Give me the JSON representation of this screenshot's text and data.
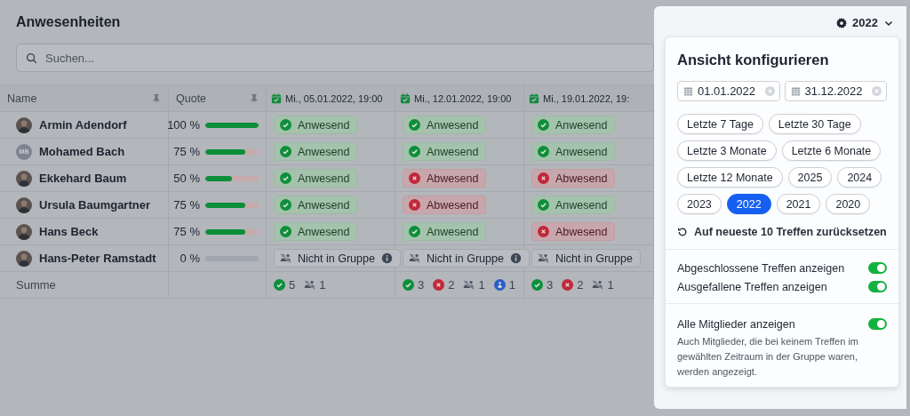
{
  "page": {
    "title": "Anwesenheiten",
    "search": {
      "placeholder": "Suchen..."
    }
  },
  "table": {
    "columns": [
      {
        "label": "Name",
        "pinned": true,
        "kind": "text"
      },
      {
        "label": "Quote",
        "pinned": true,
        "kind": "text"
      },
      {
        "label": "Mi., 05.01.2022, 19:00",
        "kind": "meeting"
      },
      {
        "label": "Mi., 12.01.2022, 19:00",
        "kind": "meeting"
      },
      {
        "label": "Mi., 19.01.2022, 19:",
        "kind": "meeting"
      }
    ],
    "rows": [
      {
        "cells": [
          {
            "kind": "member",
            "name": "Armin Adendorf",
            "avatar": {
              "kind": "photo"
            }
          },
          {
            "kind": "quote",
            "text": "100 %",
            "level": 1
          },
          {
            "kind": "present",
            "label": "Anwesend"
          },
          {
            "kind": "present",
            "label": "Anwesend"
          },
          {
            "kind": "present",
            "label": "Anwesend"
          }
        ]
      },
      {
        "cells": [
          {
            "kind": "member",
            "name": "Mohamed Bach",
            "avatar": {
              "kind": "initials",
              "initials": "MB"
            }
          },
          {
            "kind": "quote",
            "text": "75 %",
            "level": 0.75
          },
          {
            "kind": "present",
            "label": "Anwesend"
          },
          {
            "kind": "present",
            "label": "Anwesend"
          },
          {
            "kind": "present",
            "label": "Anwesend"
          }
        ]
      },
      {
        "cells": [
          {
            "kind": "member",
            "name": "Ekkehard Baum",
            "avatar": {
              "kind": "photo"
            }
          },
          {
            "kind": "quote",
            "text": "50 %",
            "level": 0.5
          },
          {
            "kind": "present",
            "label": "Anwesend"
          },
          {
            "kind": "absent",
            "label": "Abwesend"
          },
          {
            "kind": "absent",
            "label": "Abwesend"
          }
        ]
      },
      {
        "cells": [
          {
            "kind": "member",
            "name": "Ursula Baumgartner",
            "avatar": {
              "kind": "photo"
            }
          },
          {
            "kind": "quote",
            "text": "75 %",
            "level": 0.75
          },
          {
            "kind": "present",
            "label": "Anwesend"
          },
          {
            "kind": "absent",
            "label": "Abwesend"
          },
          {
            "kind": "present",
            "label": "Anwesend"
          }
        ]
      },
      {
        "cells": [
          {
            "kind": "member",
            "name": "Hans Beck",
            "avatar": {
              "kind": "photo"
            }
          },
          {
            "kind": "quote",
            "text": "75 %",
            "level": 0.75
          },
          {
            "kind": "present",
            "label": "Anwesend"
          },
          {
            "kind": "present",
            "label": "Anwesend"
          },
          {
            "kind": "absent",
            "label": "Abwesend"
          }
        ]
      },
      {
        "cells": [
          {
            "kind": "member",
            "name": "Hans-Peter Ramstadt",
            "avatar": {
              "kind": "photo"
            }
          },
          {
            "kind": "quote",
            "text": "0 %",
            "level": 0
          },
          {
            "kind": "not_in_group",
            "label": "Nicht in Gruppe",
            "info": true
          },
          {
            "kind": "not_in_group",
            "label": "Nicht in Gruppe",
            "info": true
          },
          {
            "kind": "not_in_group",
            "label": "Nicht in Gruppe",
            "info": false
          }
        ]
      }
    ],
    "summary": {
      "label": "Summe",
      "columns": [
        [
          {
            "kind": "present",
            "count": "5"
          },
          {
            "kind": "not_in_group",
            "count": "1"
          }
        ],
        [
          {
            "kind": "present",
            "count": "3"
          },
          {
            "kind": "absent",
            "count": "2"
          },
          {
            "kind": "not_in_group",
            "count": "1"
          },
          {
            "kind": "excused",
            "count": "1"
          }
        ],
        [
          {
            "kind": "present",
            "count": "3"
          },
          {
            "kind": "absent",
            "count": "2"
          },
          {
            "kind": "not_in_group",
            "count": "1"
          }
        ]
      ]
    }
  },
  "year_menu": {
    "label": "2022",
    "expanded": true
  },
  "popover": {
    "title": "Ansicht konfigurieren",
    "date_from": "01.01.2022",
    "date_to": "31.12.2022",
    "presets": [
      {
        "label": "Letzte 7 Tage",
        "selected": false
      },
      {
        "label": "Letzte 30 Tage",
        "selected": false
      },
      {
        "label": "Letzte 3 Monate",
        "selected": false
      },
      {
        "label": "Letzte 6 Monate",
        "selected": false
      },
      {
        "label": "Letzte 12 Monate",
        "selected": false
      },
      {
        "label": "2025",
        "selected": false
      },
      {
        "label": "2024",
        "selected": false
      },
      {
        "label": "2023",
        "selected": false
      },
      {
        "label": "2022",
        "selected": true
      },
      {
        "label": "2021",
        "selected": false
      },
      {
        "label": "2020",
        "selected": false
      }
    ],
    "reset_link": "Auf neueste 10 Treffen zurücksetzen",
    "toggles": [
      {
        "label": "Abgeschlossene Treffen anzeigen",
        "on": true
      },
      {
        "label": "Ausgefallene Treffen anzeigen",
        "on": true
      }
    ],
    "member_toggle": {
      "label": "Alle Mitglieder anzeigen",
      "on": true,
      "description": "Auch Mitglieder, die bei keinem Treffen im gewählten Zeitraum in der Gruppe waren, werden angezeigt."
    }
  }
}
